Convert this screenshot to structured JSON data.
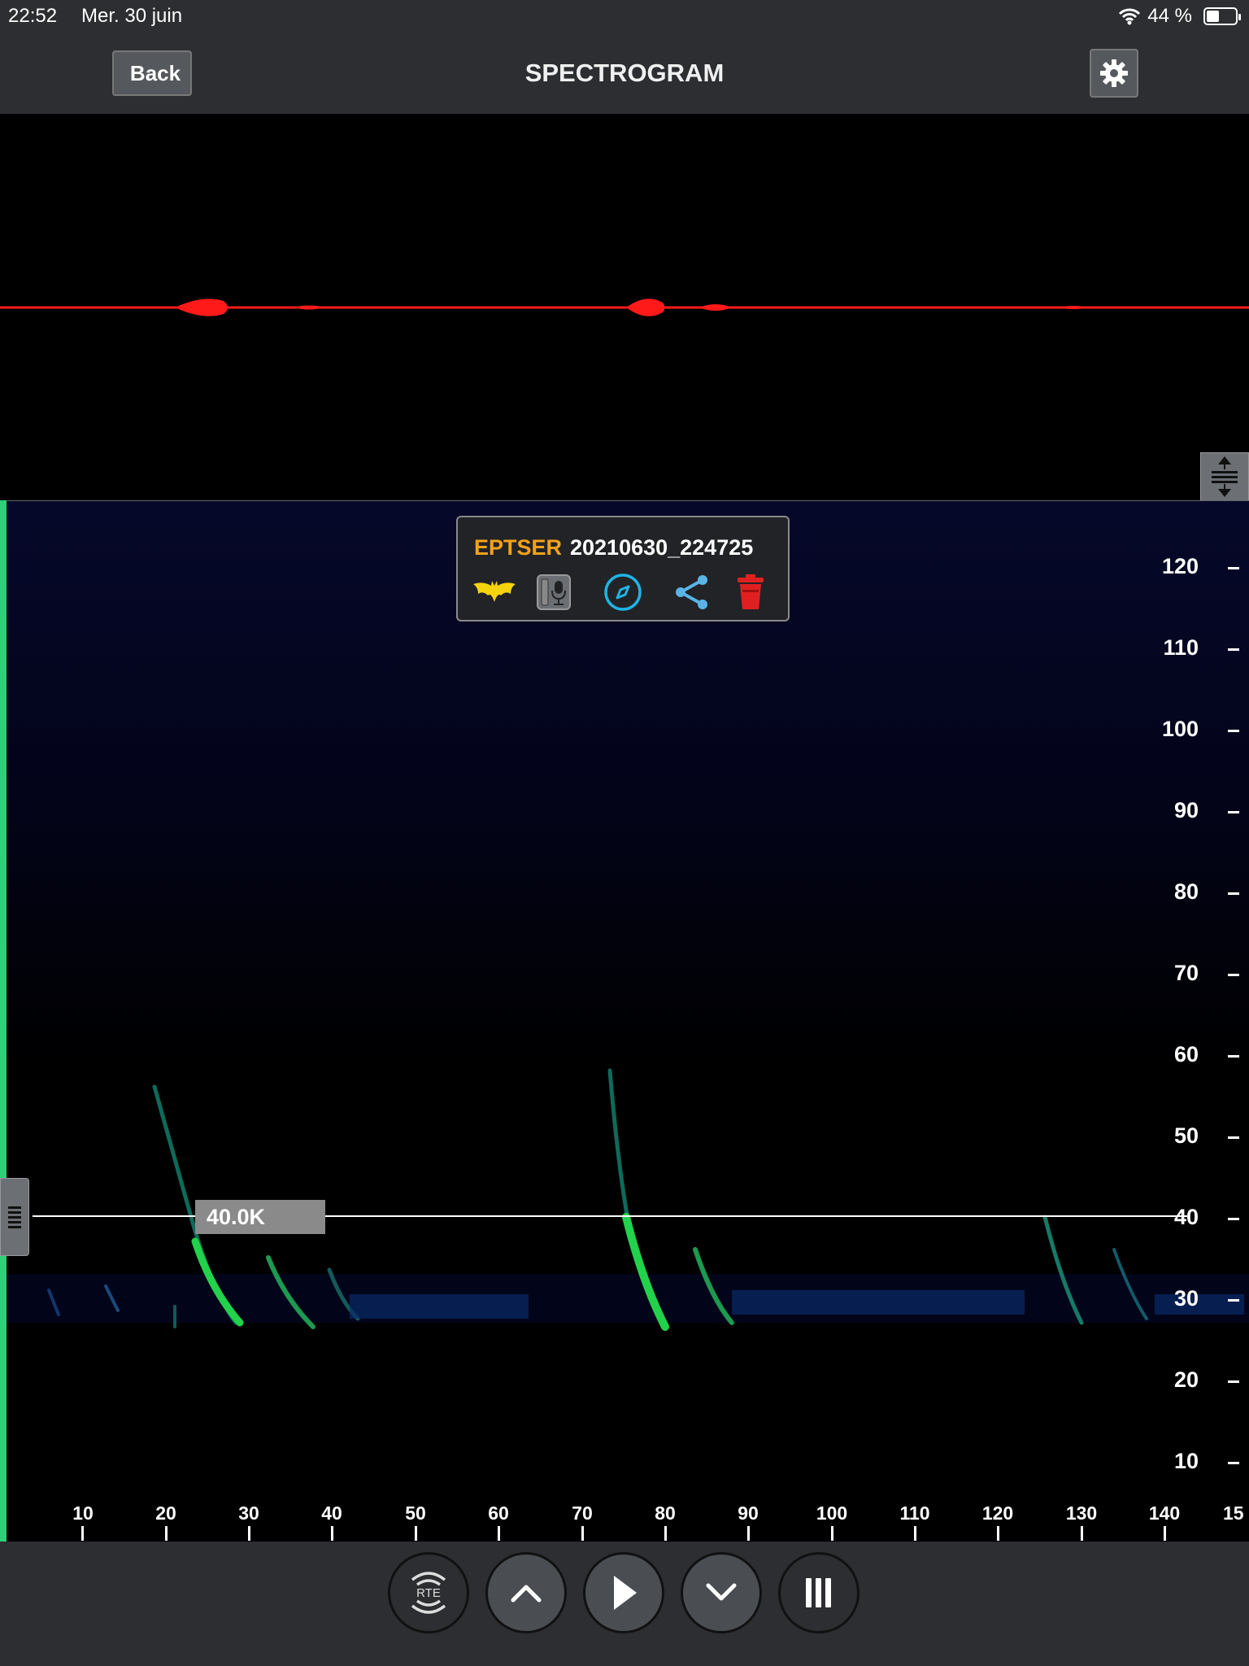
{
  "status_bar": {
    "time": "22:52",
    "date": "Mer. 30 juin",
    "battery_text": "44 %",
    "battery_level": 0.44
  },
  "nav": {
    "back_label": "Back",
    "title": "SPECTROGRAM",
    "settings_icon": "gear-icon"
  },
  "recording": {
    "species": "EPTSER",
    "filename": "20210630_224725"
  },
  "popup_icons": [
    "bat-icon",
    "microphone-info-icon",
    "compass-icon",
    "share-icon",
    "trash-icon"
  ],
  "cursor": {
    "label": "40.0K",
    "frequency_khz": 40
  },
  "y_axis": {
    "ticks": [
      "120",
      "110",
      "100",
      "90",
      "80",
      "70",
      "60",
      "50",
      "40",
      "30",
      "20",
      "10"
    ]
  },
  "x_axis": {
    "ticks": [
      "10",
      "20",
      "30",
      "40",
      "50",
      "60",
      "70",
      "80",
      "90",
      "100",
      "110",
      "120",
      "130",
      "140",
      "15"
    ]
  },
  "toolbar": {
    "rte_label": "RTE",
    "buttons": [
      "rte-button",
      "up-button",
      "play-button",
      "down-button",
      "bars-button"
    ]
  },
  "colors": {
    "waveform": "#ff1a1a",
    "species": "#f4a21a",
    "cursor_marker": "#2fd07a",
    "background": "#000000",
    "chrome": "#2c2e31"
  }
}
